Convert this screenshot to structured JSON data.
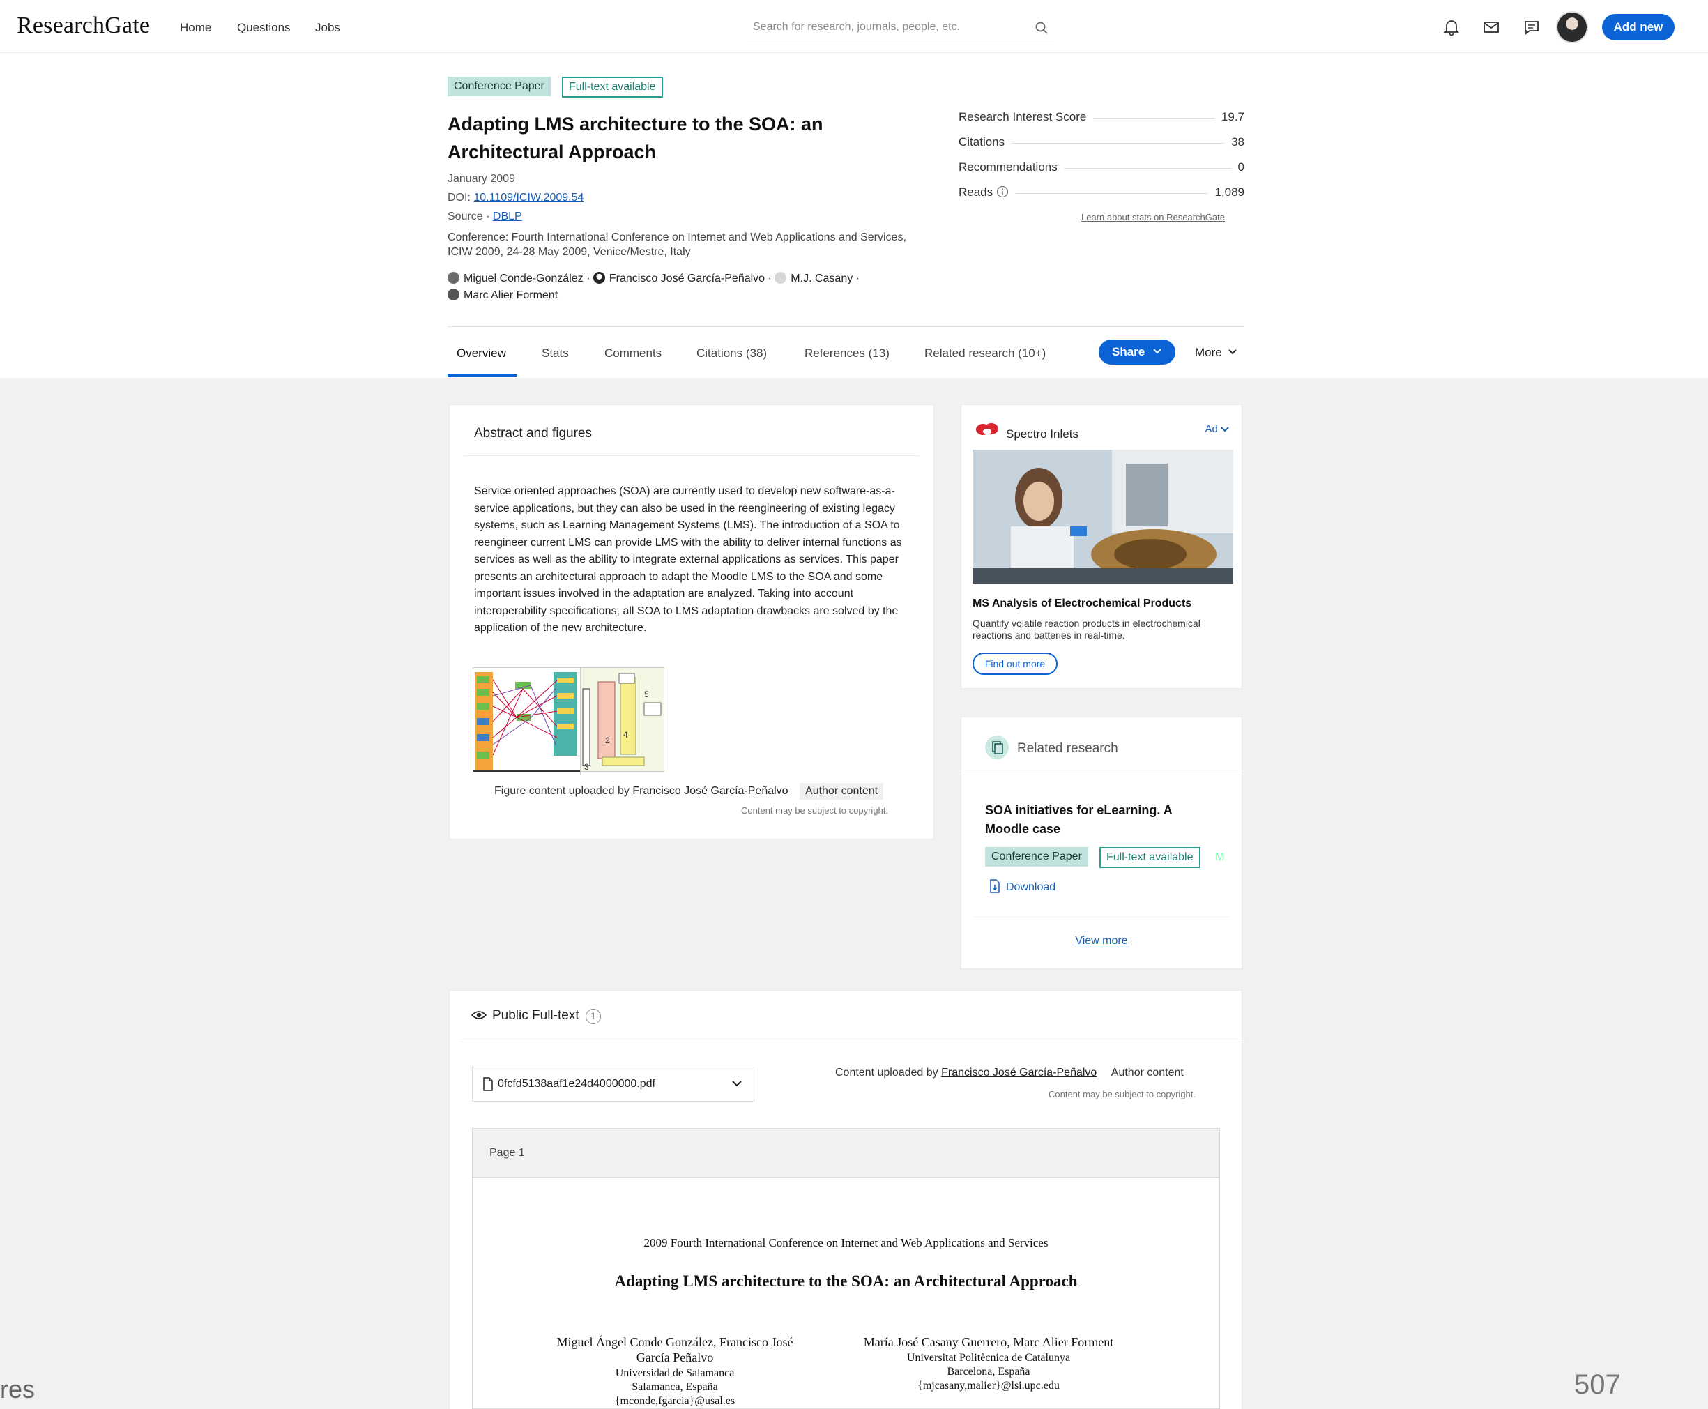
{
  "header": {
    "logo": "ResearchGate",
    "nav": [
      "Home",
      "Questions",
      "Jobs"
    ],
    "search_placeholder": "Search for research, journals, people, etc.",
    "add_new_label": "Add new"
  },
  "paper": {
    "type_badge": "Conference Paper",
    "fulltext_badge": "Full-text available",
    "title": "Adapting LMS architecture to the SOA: an Architectural Approach",
    "date": "January 2009",
    "doi_prefix": "DOI:",
    "doi": "10.1109/ICIW.2009.54",
    "source_prefix": "Source ·",
    "source": "DBLP",
    "conference": "Conference: Fourth International Conference on Internet and Web Applications and Services, ICIW 2009, 24-28 May 2009, Venice/Mestre, Italy",
    "authors": [
      "Miguel Conde-González",
      "Francisco José García-Peñalvo",
      "M.J. Casany",
      "Marc Alier Forment"
    ]
  },
  "stats": {
    "rows": [
      {
        "label": "Research Interest Score",
        "value": "19.7"
      },
      {
        "label": "Citations",
        "value": "38"
      },
      {
        "label": "Recommendations",
        "value": "0"
      },
      {
        "label": "Reads",
        "value": "1,089"
      }
    ],
    "learn_link": "Learn about stats on ResearchGate"
  },
  "tabs": [
    "Overview",
    "Stats",
    "Comments",
    "Citations (38)",
    "References (13)",
    "Related research (10+)"
  ],
  "share_label": "Share",
  "more_label": "More",
  "abstract": {
    "heading": "Abstract and figures",
    "text": "Service oriented approaches (SOA) are currently used to develop new software-as-a-service applications, but they can also be used in the reengineering of existing legacy systems, such as Learning Management Systems (LMS). The introduction of a SOA to reengineer current LMS can provide LMS with the ability to deliver internal functions as services as well as the ability to integrate external applications as services. This paper presents an architectural approach to adapt the Moodle LMS to the SOA and some important issues involved in the adaptation are analyzed. Taking into account interoperability specifications, all SOA to LMS adaptation drawbacks are solved by the application of the new architecture.",
    "figure_caption": "Figure content uploaded by",
    "figure_uploader": "Francisco José García-Peñalvo",
    "author_content": "Author content",
    "copyright": "Content may be subject to copyright."
  },
  "ad": {
    "brand": "Spectro Inlets",
    "label": "Ad",
    "headline": "MS Analysis of Electrochemical Products",
    "body": "Quantify volatile reaction products in electrochemical reactions and batteries in real-time.",
    "cta": "Find out more"
  },
  "related": {
    "heading": "Related research",
    "paper_title": "SOA initiatives for eLearning. A Moodle case",
    "type_badge": "Conference Paper",
    "fulltext_badge": "Full-text available",
    "overflow": "M",
    "download": "Download",
    "view_more": "View more"
  },
  "fulltext": {
    "heading": "Public Full-text",
    "info_count": "1",
    "file_name": "0fcfd5138aaf1e24d4000000.pdf",
    "uploaded_by": "Content uploaded by",
    "uploader": "Francisco José García-Peñalvo",
    "author_content": "Author content",
    "copyright": "Content may be subject to copyright.",
    "page_label": "Page 1",
    "pdf_conference": "2009 Fourth International Conference on Internet and Web Applications and Services",
    "pdf_title": "Adapting LMS architecture to the SOA: an Architectural Approach",
    "pdf_authors_left_1": "Miguel Ángel Conde González, Francisco José",
    "pdf_authors_left_2": "García Peñalvo",
    "pdf_affil_left_1": "Universidad de Salamanca",
    "pdf_affil_left_2": "Salamanca, España",
    "pdf_email_left": "{mconde,fgarcia}@usal.es",
    "pdf_authors_right": "María José Casany Guerrero, Marc Alier Forment",
    "pdf_affil_right_1": "Universitat Politècnica de Catalunya",
    "pdf_affil_right_2": "Barcelona, España",
    "pdf_email_right": "{mjcasany,malier}@lsi.upc.edu"
  },
  "edge_text": {
    "left": "res",
    "right": "507"
  },
  "colors": {
    "accent": "#0b63d6",
    "badge_fill": "#bfe3dd",
    "badge_outline": "#2a9d8f",
    "body_gray": "#f1f1f1"
  }
}
